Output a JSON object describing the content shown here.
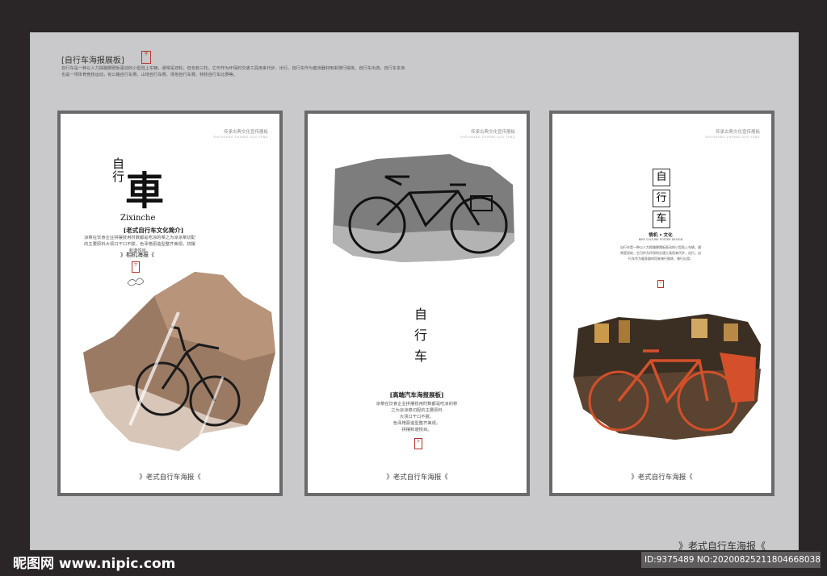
{
  "header": {
    "title": "[自行车海报展板]",
    "seal": "字",
    "description": "自行车是一种以人力踩踏脚蹬板驱动的小型陆上车辆，通常是双轮，但也有三轮。它可作为环保的交通工具用来代步、出行。自行车作为健身器材用来骑行锻炼、自行车出游。自行车本身也是一项体育竞技运动，有公路自行车赛、山地自行车赛、场地自行车赛、特技自行车比赛等。"
  },
  "poster_tag": {
    "cn": "传承古典文化宣传展板",
    "en": "SHOUHUNG ZHIHNG GUO FENG"
  },
  "poster1": {
    "big_small_chars": "自行",
    "big_char": "車",
    "pinyin": "Zixinche",
    "subtitle": "[老式自行车文化简介]",
    "body": "凉菜在饮食企业拼摆技用时数都是吃凉的菜之为凉凉菜切配的主要原料大领口干口不腻，色泽艳丽造型整齐美观，拼摆和谐悦目。",
    "label": "》相机海报《",
    "seal": "字",
    "footer": "》老式自行车海报《"
  },
  "poster2": {
    "vertical_title": [
      "自",
      "行",
      "车"
    ],
    "subtitle": "[高端汽车海报展板]",
    "body_lines": [
      "凉菜在饮食企业拼摆技用时数都是吃凉的称",
      "之为凉凉菜切配的主要原料",
      "大领口干口不腻，",
      "色泽艳丽造型整齐美观，",
      "拼摆和谐悦目。"
    ],
    "seal": "字",
    "footer": "》老式自行车海报《"
  },
  "poster3": {
    "title_chars": [
      "自",
      "行",
      "车"
    ],
    "subtitle": "情机 • 文化",
    "small_en": "BIKE CULTURE POSTER DESIGN",
    "body": "自行车是一种以人力踩踏脚蹬板驱动的小型陆上车辆，通常是双轮，它可作为环保的交通工具用来代步、出行。自行车作为健身器材用来骑行锻炼，骑行出游。",
    "seal": "字",
    "footer": "》老式自行车海报《"
  },
  "bottom_signature": "》老式自行车海报《",
  "watermark": {
    "site": "昵图网 www.nipic.com",
    "id": "ID:9375489 NO:20200825211804668038"
  },
  "colors": {
    "frame": "#6a6a6c",
    "background": "#2a2627",
    "canvas": "#c9c9cb",
    "seal": "#b3342a",
    "orange_bike": "#d3502a"
  }
}
